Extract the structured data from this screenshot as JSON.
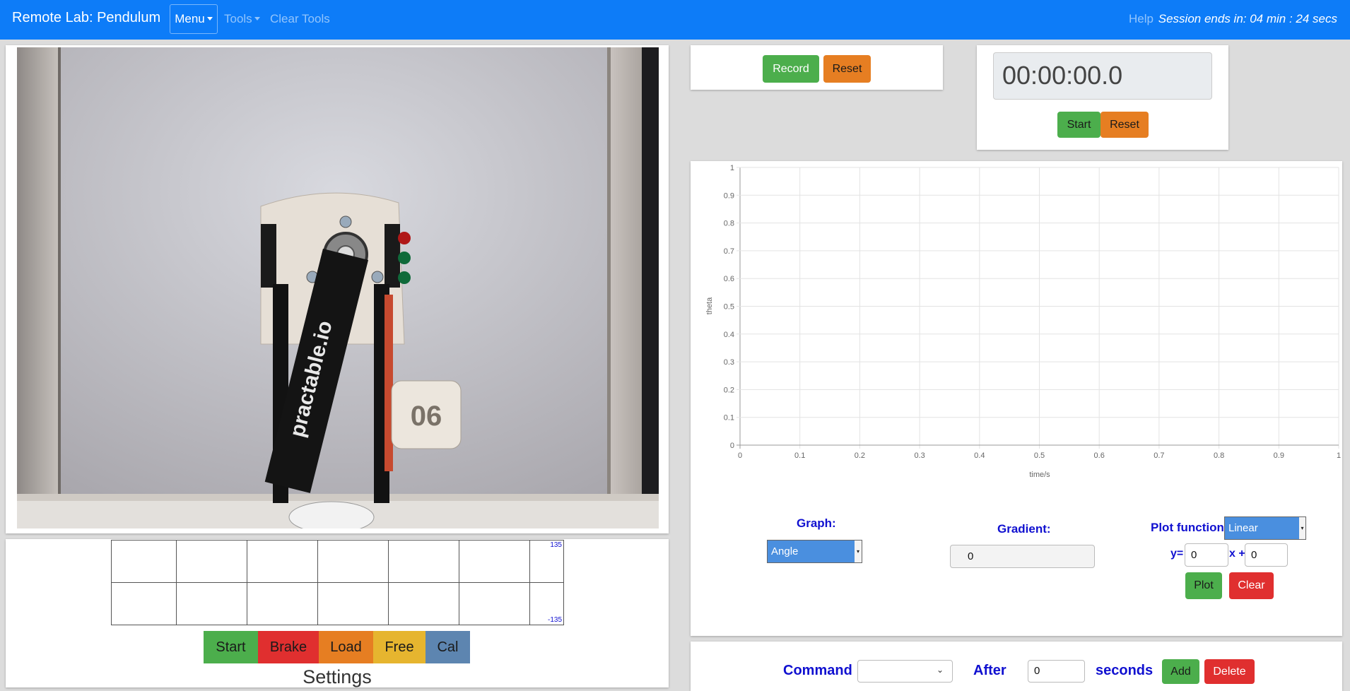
{
  "navbar": {
    "title": "Remote Lab: Pendulum",
    "menu_label": "Menu",
    "tools_label": "Tools",
    "clear_tools_label": "Clear Tools",
    "help_label": "Help",
    "session_text": "Session ends in: 04 min : 24 secs"
  },
  "video": {
    "plate_number": "06",
    "arm_text": "practable.io"
  },
  "strip_chart": {
    "top_label": "135",
    "bottom_label": "-135"
  },
  "controls": {
    "start": "Start",
    "brake": "Brake",
    "load": "Load",
    "free": "Free",
    "cal": "Cal"
  },
  "settings_heading": "Settings",
  "recorder": {
    "record": "Record",
    "reset": "Reset"
  },
  "stopwatch": {
    "display": "00:00:00.0",
    "start": "Start",
    "reset": "Reset"
  },
  "chart_data": {
    "type": "line",
    "xlabel": "time/s",
    "ylabel": "theta",
    "xlim": [
      0,
      1
    ],
    "ylim": [
      0,
      1
    ],
    "x_ticks": [
      "0",
      "0.1",
      "0.2",
      "0.3",
      "0.4",
      "0.5",
      "0.6",
      "0.7",
      "0.8",
      "0.9",
      "1"
    ],
    "y_ticks": [
      "0",
      "0.1",
      "0.2",
      "0.3",
      "0.4",
      "0.5",
      "0.6",
      "0.7",
      "0.8",
      "0.9",
      "1"
    ],
    "grid": true,
    "series": []
  },
  "graph_controls": {
    "graph_label": "Graph:",
    "graph_value": "Angle",
    "gradient_label": "Gradient:",
    "gradient_value": "0",
    "plot_function_label": "Plot function:",
    "plot_function_value": "Linear",
    "y_label": "y=",
    "x_label": "x +",
    "m_value": "0",
    "c_value": "0",
    "plot": "Plot",
    "clear": "Clear"
  },
  "command_bar": {
    "command_label": "Command",
    "after_label": "After",
    "after_value": "0",
    "seconds_label": "seconds",
    "add": "Add",
    "delete": "Delete"
  },
  "colors": {
    "navbar": "#0d7cf8",
    "green": "#4cae4c",
    "orange": "#e67e22",
    "red": "#e02f2f",
    "yellow": "#e6b52f",
    "steel": "#5d85b0",
    "label_blue": "#1010d0"
  }
}
